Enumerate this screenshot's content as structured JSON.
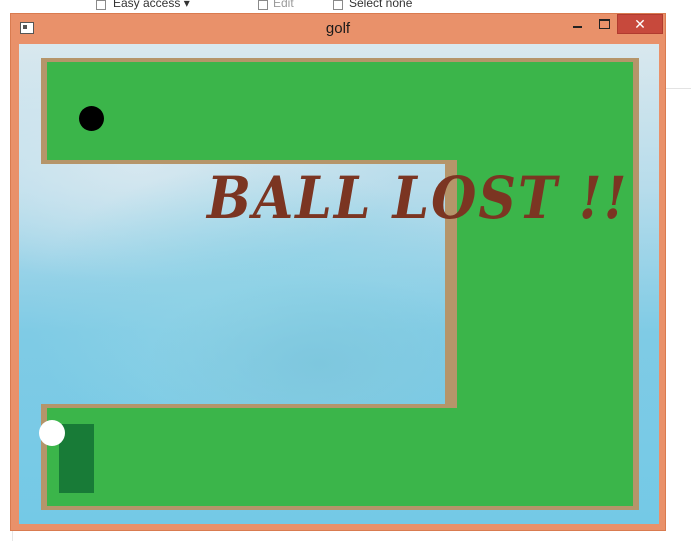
{
  "background_window": {
    "ribbon": {
      "easy_access_label": "Easy access ▾",
      "edit_label": "Edit",
      "select_none_label": "Select none"
    }
  },
  "window": {
    "title": "golf",
    "controls": {
      "close_glyph": "✕"
    }
  },
  "game": {
    "message": "BALL LOST !!",
    "colors": {
      "grass": "#3bb54a",
      "rail": "#b5956a",
      "tee": "#187b37",
      "message": "#7b3522",
      "hole": "#000000",
      "ball": "#ffffff"
    }
  }
}
